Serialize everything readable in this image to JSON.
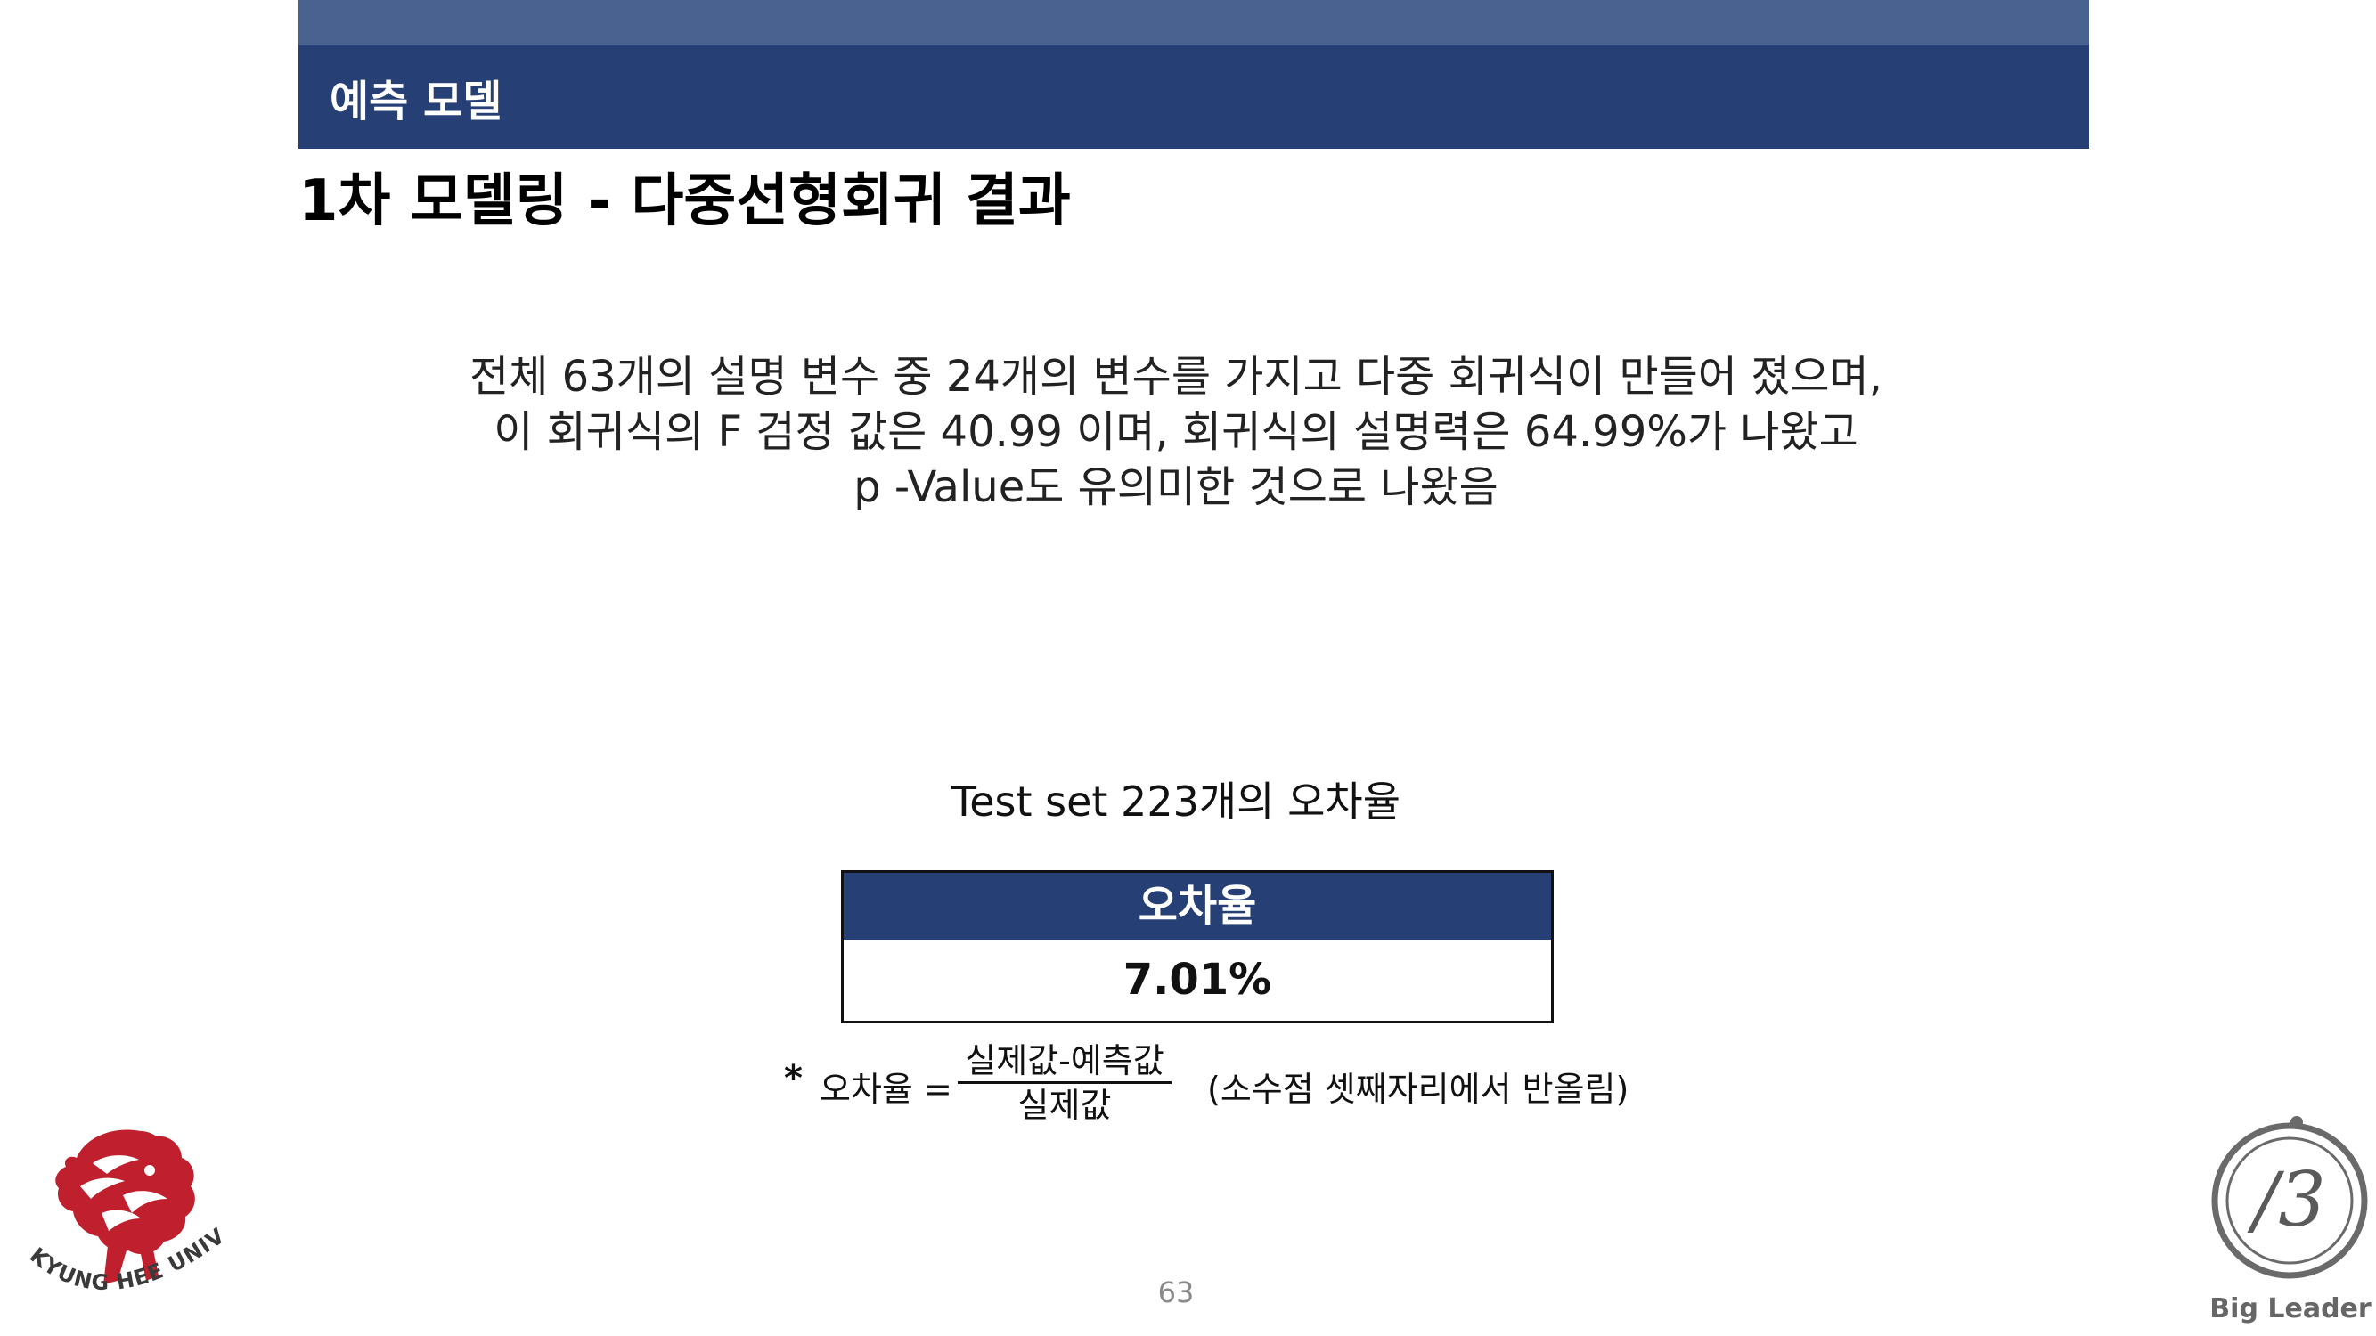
{
  "header": {
    "section_title": "예측 모델"
  },
  "page": {
    "title": "1차 모델링 - 다중선형회귀 결과",
    "number": "63"
  },
  "summary": {
    "lines": [
      "전체 63개의 설명 변수 중 24개의 변수를 가지고 다중 회귀식이 만들어 졌으며,",
      "이 회귀식의 F 검정 값은 40.99 이며, 회귀식의 설명력은 64.99%가 나왔고",
      "p -Value도 유의미한 것으로 나왔음"
    ]
  },
  "error_table": {
    "caption": "Test set 223개의 오차율",
    "header": "오차율",
    "value": "7.01%"
  },
  "formula": {
    "bullet": "*",
    "lhs": "오차율 =",
    "numerator": "실제값-예측값",
    "denominator": "실제값",
    "note": "(소수점 셋째자리에서 반올림)"
  },
  "logos": {
    "left": "KYUNG HEE UNIVERSITY",
    "right": "Big Leader",
    "right_mark": "/3"
  },
  "colors": {
    "header_dark": "#263f75",
    "header_light": "#4a6290",
    "khu_red": "#c0202e",
    "bl_gray": "#666666"
  }
}
